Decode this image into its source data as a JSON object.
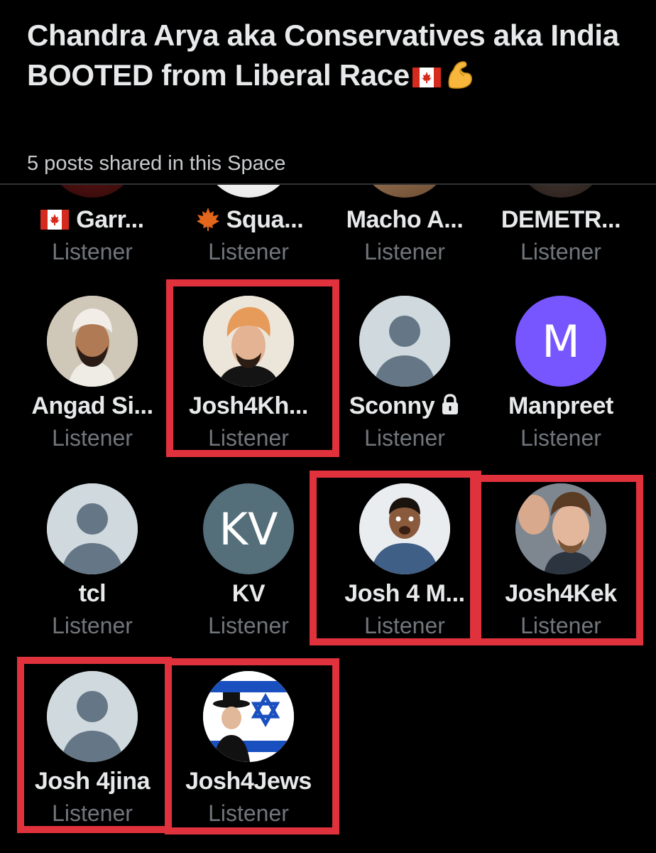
{
  "space": {
    "title": "Chandra Arya  aka Conservatives aka India BOOTED from Liberal Race",
    "subtitle": "5 posts shared in this Space"
  },
  "participants": [
    {
      "name": "Garr...",
      "role": "Listener",
      "icon": "canada-flag-icon"
    },
    {
      "name": "Squa...",
      "role": "Listener",
      "icon": "maple-leaf-icon"
    },
    {
      "name": "Macho A...",
      "role": "Listener"
    },
    {
      "name": "DEMETR...",
      "role": "Listener"
    },
    {
      "name": "Angad Si...",
      "role": "Listener"
    },
    {
      "name": "Josh4Kh...",
      "role": "Listener",
      "highlighted": true
    },
    {
      "name": "Sconny",
      "role": "Listener",
      "icon": "lock-icon"
    },
    {
      "name": "Manpreet",
      "role": "Listener",
      "avatar_letter": "M",
      "avatar_color": "#7856ff"
    },
    {
      "name": "tcl",
      "role": "Listener"
    },
    {
      "name": "KV",
      "role": "Listener",
      "avatar_letter": "KV",
      "avatar_color": "#546e7a"
    },
    {
      "name": "Josh 4 M...",
      "role": "Listener",
      "highlighted": true
    },
    {
      "name": "Josh4Kek",
      "role": "Listener",
      "highlighted": true
    },
    {
      "name": "Josh 4jina",
      "role": "Listener",
      "highlighted": true
    },
    {
      "name": "Josh4Jews",
      "role": "Listener",
      "highlighted": true
    }
  ],
  "colors": {
    "background": "#000000",
    "highlight": "#e0323c",
    "muted": "#71767b",
    "accent_avatar": "#7856ff"
  }
}
